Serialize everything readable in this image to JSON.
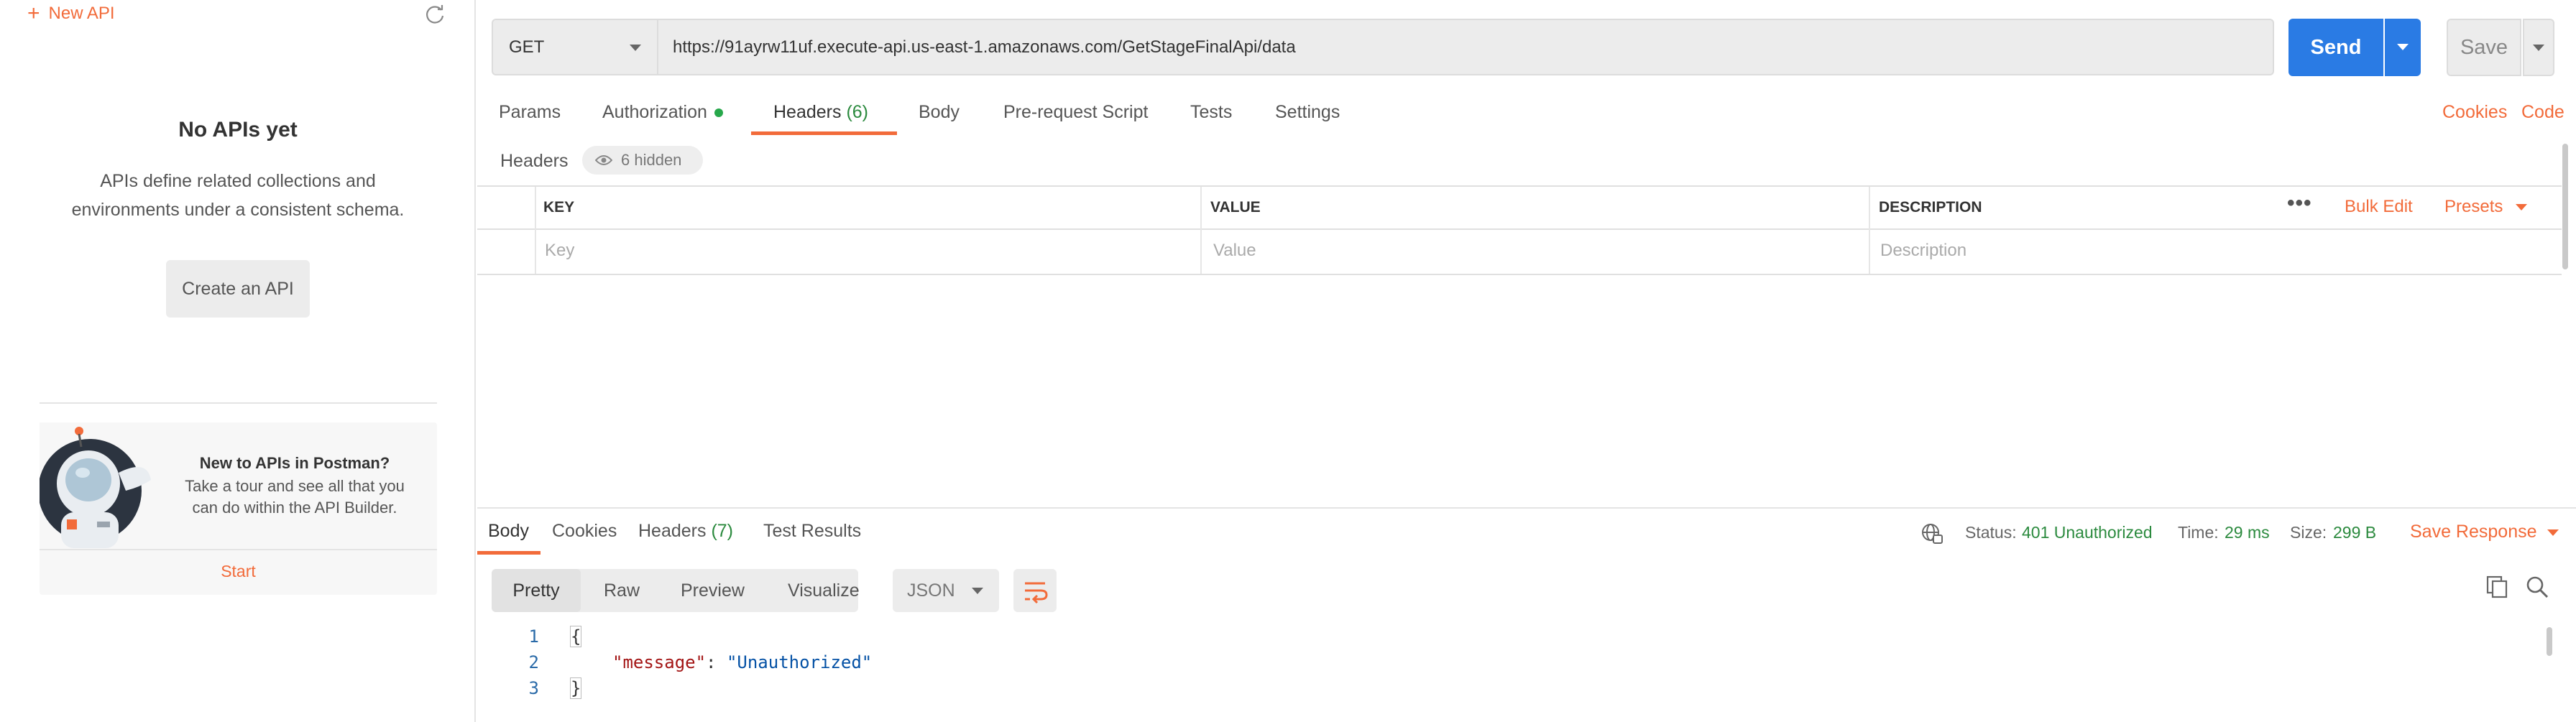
{
  "sidebar": {
    "new_api_label": "New API",
    "empty_title": "No APIs yet",
    "empty_desc_line1": "APIs define related collections and",
    "empty_desc_line2": "environments under a consistent schema.",
    "create_button": "Create an API",
    "tour_title": "New to APIs in Postman?",
    "tour_text_line1": "Take a tour and see all that you",
    "tour_text_line2": "can do within the API Builder.",
    "tour_start": "Start"
  },
  "request": {
    "method": "GET",
    "url": "https://91ayrw11uf.execute-api.us-east-1.amazonaws.com/GetStageFinalApi/data",
    "send_label": "Send",
    "save_label": "Save"
  },
  "request_tabs": {
    "params": "Params",
    "authorization": "Authorization",
    "headers": "Headers",
    "headers_count": "(6)",
    "body": "Body",
    "prerequest": "Pre-request Script",
    "tests": "Tests",
    "settings": "Settings",
    "cookies": "Cookies",
    "code": "Code"
  },
  "headers_section": {
    "label": "Headers",
    "hidden_badge": "6 hidden",
    "col_key": "KEY",
    "col_value": "VALUE",
    "col_description": "DESCRIPTION",
    "more": "•••",
    "bulk_edit": "Bulk Edit",
    "presets": "Presets",
    "placeholder_key": "Key",
    "placeholder_value": "Value",
    "placeholder_description": "Description"
  },
  "response_tabs": {
    "body": "Body",
    "cookies": "Cookies",
    "headers": "Headers",
    "headers_count": "(7)",
    "test_results": "Test Results"
  },
  "response_meta": {
    "status_label": "Status:",
    "status_value": "401 Unauthorized",
    "time_label": "Time:",
    "time_value": "29 ms",
    "size_label": "Size:",
    "size_value": "299 B",
    "save_response": "Save Response"
  },
  "response_view": {
    "pretty": "Pretty",
    "raw": "Raw",
    "preview": "Preview",
    "visualize": "Visualize",
    "format": "JSON"
  },
  "response_body": {
    "line_numbers": [
      "1",
      "2",
      "3"
    ],
    "open_brace": "{",
    "key": "\"message\"",
    "colon": ": ",
    "value": "\"Unauthorized\"",
    "close_brace": "}"
  },
  "colors": {
    "accent": "#f26b3a",
    "send": "#2a7be4",
    "status_ok_text": "#2b8a3e"
  },
  "icons": [
    "plus-icon",
    "refresh-icon",
    "caret-down-icon",
    "eye-icon",
    "globe-icon",
    "wrap-icon",
    "copy-icon",
    "search-icon",
    "astronaut-illustration"
  ]
}
